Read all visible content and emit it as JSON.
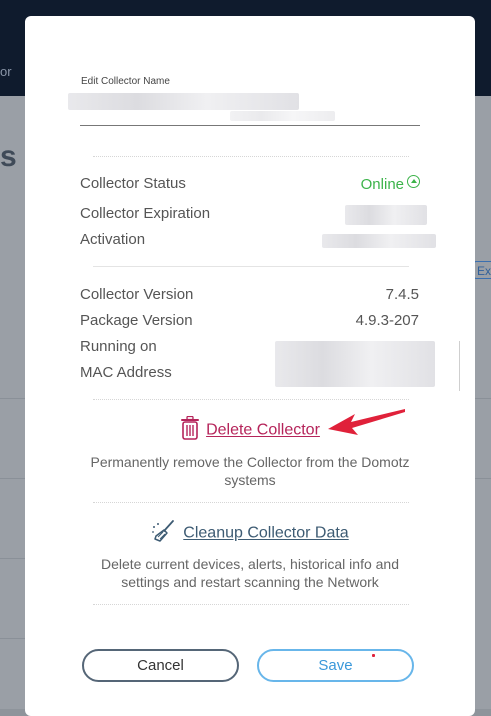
{
  "background": {
    "nav_fragment": "or",
    "heading_fragment": "s",
    "badge_fragment": "Ex"
  },
  "modal": {
    "edit_name_label": "Edit Collector Name",
    "rows_status": [
      {
        "label": "Collector Status",
        "value": "Online"
      },
      {
        "label": "Collector Expiration",
        "value": ""
      },
      {
        "label": "Activation",
        "value": ""
      }
    ],
    "rows_version": [
      {
        "label": "Collector Version",
        "value": "7.4.5"
      },
      {
        "label": "Package Version",
        "value": "4.9.3-207"
      },
      {
        "label": "Running on",
        "value": ""
      },
      {
        "label": "MAC Address",
        "value": ""
      }
    ],
    "delete": {
      "label": "Delete Collector",
      "description": "Permanently remove the Collector from the Domotz systems",
      "icon": "trash-icon"
    },
    "cleanup": {
      "label": "Cleanup Collector Data",
      "description": "Delete current devices, alerts, historical info and settings and restart scanning the Network",
      "icon": "broom-icon"
    },
    "cancel_label": "Cancel",
    "save_label": "Save"
  },
  "colors": {
    "online_green": "#3cb34a",
    "delete_pink": "#b5245a",
    "save_blue": "#3a98da",
    "annotation_arrow": "#e0213a"
  }
}
